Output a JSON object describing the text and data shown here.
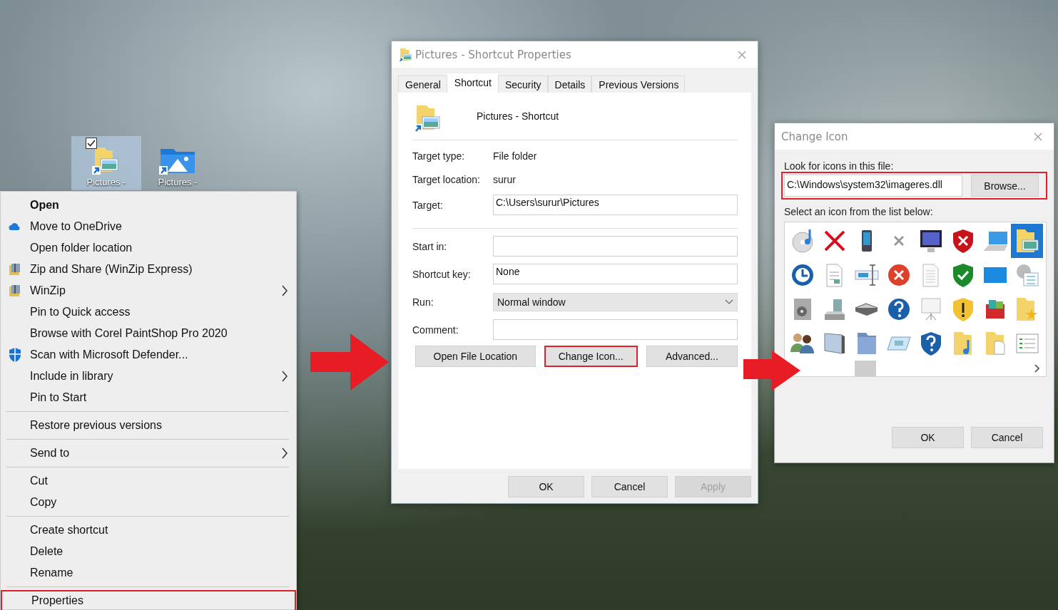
{
  "desktop_icons": [
    {
      "label": "Pictures -",
      "selected": true,
      "checked": true
    },
    {
      "label": "Pictures -",
      "selected": false,
      "checked": false
    }
  ],
  "context_menu": {
    "items": [
      {
        "kind": "item",
        "label": "Open",
        "default": true,
        "submenu": false,
        "highlighted": false
      },
      {
        "kind": "item",
        "label": "Move to OneDrive",
        "default": false,
        "submenu": false,
        "highlighted": false
      },
      {
        "kind": "item",
        "label": "Open folder location",
        "default": false,
        "submenu": false,
        "highlighted": false
      },
      {
        "kind": "item",
        "label": "Zip and Share (WinZip Express)",
        "default": false,
        "submenu": false,
        "highlighted": false
      },
      {
        "kind": "item",
        "label": "WinZip",
        "default": false,
        "submenu": true,
        "highlighted": false
      },
      {
        "kind": "item",
        "label": "Pin to Quick access",
        "default": false,
        "submenu": false,
        "highlighted": false
      },
      {
        "kind": "item",
        "label": "Browse with Corel PaintShop Pro 2020",
        "default": false,
        "submenu": false,
        "highlighted": false
      },
      {
        "kind": "item",
        "label": "Scan with Microsoft Defender...",
        "default": false,
        "submenu": false,
        "highlighted": false
      },
      {
        "kind": "item",
        "label": "Include in library",
        "default": false,
        "submenu": true,
        "highlighted": false
      },
      {
        "kind": "item",
        "label": "Pin to Start",
        "default": false,
        "submenu": false,
        "highlighted": false
      },
      {
        "kind": "separator"
      },
      {
        "kind": "item",
        "label": "Restore previous versions",
        "default": false,
        "submenu": false,
        "highlighted": false
      },
      {
        "kind": "separator"
      },
      {
        "kind": "item",
        "label": "Send to",
        "default": false,
        "submenu": true,
        "highlighted": false
      },
      {
        "kind": "separator"
      },
      {
        "kind": "item",
        "label": "Cut",
        "default": false,
        "submenu": false,
        "highlighted": false
      },
      {
        "kind": "item",
        "label": "Copy",
        "default": false,
        "submenu": false,
        "highlighted": false
      },
      {
        "kind": "separator"
      },
      {
        "kind": "item",
        "label": "Create shortcut",
        "default": false,
        "submenu": false,
        "highlighted": false
      },
      {
        "kind": "item",
        "label": "Delete",
        "default": false,
        "submenu": false,
        "highlighted": false
      },
      {
        "kind": "item",
        "label": "Rename",
        "default": false,
        "submenu": false,
        "highlighted": false
      },
      {
        "kind": "separator"
      },
      {
        "kind": "item",
        "label": "Properties",
        "default": false,
        "submenu": false,
        "highlighted": true
      }
    ]
  },
  "properties_dialog": {
    "title": "Pictures - Shortcut Properties",
    "tabs": [
      {
        "label": "General",
        "selected": false
      },
      {
        "label": "Shortcut",
        "selected": true
      },
      {
        "label": "Security",
        "selected": false
      },
      {
        "label": "Details",
        "selected": false
      },
      {
        "label": "Previous Versions",
        "selected": false
      }
    ],
    "name": "Pictures - Shortcut",
    "info_rows": [
      {
        "label": "Target type:",
        "value": "File folder"
      },
      {
        "label": "Target location:",
        "value": "surur"
      }
    ],
    "fields": [
      {
        "kind": "text",
        "label": "Target:",
        "value": "C:\\Users\\surur\\Pictures"
      },
      {
        "kind": "text",
        "label": "Start in:"
      },
      {
        "kind": "text",
        "label": "Shortcut key:",
        "value": "None"
      },
      {
        "kind": "select",
        "label": "Run:",
        "value": "Normal window"
      },
      {
        "kind": "text",
        "label": "Comment:"
      }
    ],
    "action_buttons": [
      {
        "label": "Open File Location",
        "highlighted": false
      },
      {
        "label": "Change Icon...",
        "highlighted": true
      },
      {
        "label": "Advanced...",
        "highlighted": false
      }
    ],
    "footer_buttons": [
      {
        "label": "OK",
        "disabled": false
      },
      {
        "label": "Cancel",
        "disabled": false
      },
      {
        "label": "Apply",
        "disabled": true
      }
    ]
  },
  "change_icon_dialog": {
    "title": "Change Icon",
    "file_label": "Look for icons in this file:",
    "file_path": "C:\\Windows\\system32\\imageres.dll",
    "browse_label": "Browse...",
    "file_row_highlighted": true,
    "list_label": "Select an icon from the list below:",
    "icons": [
      {
        "selected": false
      },
      {
        "selected": false
      },
      {
        "selected": false
      },
      {
        "selected": false
      },
      {
        "selected": false
      },
      {
        "selected": false
      },
      {
        "selected": false
      },
      {
        "selected": true
      },
      {
        "selected": false
      },
      {
        "selected": false
      },
      {
        "selected": false
      },
      {
        "selected": false
      },
      {
        "selected": false
      },
      {
        "selected": false
      },
      {
        "selected": false
      },
      {
        "selected": false
      },
      {
        "selected": false
      },
      {
        "selected": false
      },
      {
        "selected": false
      },
      {
        "selected": false
      },
      {
        "selected": false
      },
      {
        "selected": false
      },
      {
        "selected": false
      },
      {
        "selected": false
      },
      {
        "selected": false
      },
      {
        "selected": false
      },
      {
        "selected": false
      },
      {
        "selected": false
      },
      {
        "selected": false
      },
      {
        "selected": false
      },
      {
        "selected": false
      },
      {
        "selected": false
      }
    ],
    "buttons": [
      {
        "label": "OK"
      },
      {
        "label": "Cancel"
      }
    ]
  }
}
